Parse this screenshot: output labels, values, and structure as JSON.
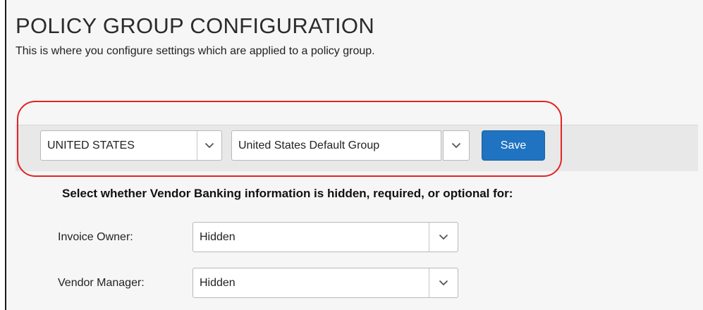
{
  "header": {
    "title": "POLICY GROUP CONFIGURATION",
    "subtitle": "This is where you configure settings which are applied to a policy group."
  },
  "toolbar": {
    "country_select": {
      "value": "UNITED STATES"
    },
    "group_select": {
      "value": "United States Default Group"
    },
    "save_label": "Save"
  },
  "banking": {
    "heading": "Select whether Vendor Banking information is hidden, required, or optional for:",
    "rows": [
      {
        "label": "Invoice Owner:",
        "value": "Hidden"
      },
      {
        "label": "Vendor Manager:",
        "value": "Hidden"
      }
    ]
  },
  "colors": {
    "accent": "#1f73c1",
    "highlight": "#e02424"
  },
  "icons": {
    "dropdown": "chevron-down-icon"
  }
}
